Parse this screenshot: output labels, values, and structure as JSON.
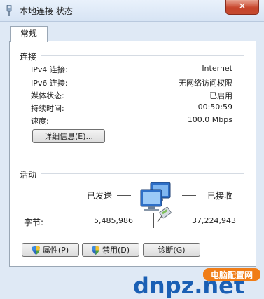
{
  "window": {
    "title": "本地连接 状态",
    "close_symbol": "✕"
  },
  "tabs": [
    {
      "label": "常规"
    }
  ],
  "connection": {
    "group_label": "连接",
    "rows": [
      {
        "label": "IPv4 连接:",
        "value": "Internet"
      },
      {
        "label": "IPv6 连接:",
        "value": "无网络访问权限"
      },
      {
        "label": "媒体状态:",
        "value": "已启用"
      },
      {
        "label": "持续时间:",
        "value": "00:50:59"
      },
      {
        "label": "速度:",
        "value": "100.0 Mbps"
      }
    ],
    "details_button": "详细信息(E)..."
  },
  "activity": {
    "group_label": "活动",
    "sent_label": "已发送",
    "received_label": "已接收",
    "bytes_label": "字节:",
    "bytes_sent": "5,485,986",
    "bytes_received": "37,224,943"
  },
  "buttons": {
    "properties": "属性(P)",
    "disable": "禁用(D)",
    "diagnose": "诊断(G)"
  },
  "watermark": {
    "brand_text": "dnpz.net",
    "badge_text": "电脑配置网"
  },
  "colors": {
    "accent_blue": "#1e63b8",
    "close_red": "#c7452b",
    "watermark_blue": "#1a5fb4",
    "watermark_orange": "#f07d17"
  }
}
